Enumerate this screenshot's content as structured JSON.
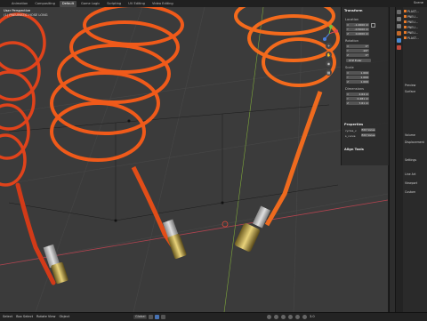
{
  "topbar": {
    "tabs": [
      "Animation",
      "Compositing",
      "Default",
      "Game Logic",
      "Scripting",
      "UV Editing",
      "Video Editing"
    ],
    "active_tab": "Default",
    "scene_label": "Scene"
  },
  "viewport": {
    "mode": "User Perspective",
    "collection": "(1) PNEUMATIC HOSE LONG",
    "npanel": {
      "transform_header": "Transform",
      "location_label": "Location",
      "location": [
        {
          "axis": "X",
          "value": "-1.0000 m"
        },
        {
          "axis": "Y",
          "value": "-0.5000 m"
        },
        {
          "axis": "Z",
          "value": "0.0000 m"
        }
      ],
      "rotation_label": "Rotation",
      "rotation": [
        {
          "axis": "X",
          "value": "0°"
        },
        {
          "axis": "Y",
          "value": "-90°"
        },
        {
          "axis": "Z",
          "value": "0°"
        }
      ],
      "rotation_mode": "XYZ Euler",
      "scale_label": "Scale",
      "scale": [
        {
          "axis": "X",
          "value": "1.000"
        },
        {
          "axis": "Y",
          "value": "1.000"
        },
        {
          "axis": "Z",
          "value": "1.000"
        }
      ],
      "dimensions_label": "Dimensions",
      "dimensions": [
        {
          "axis": "X",
          "value": "2.64 m"
        },
        {
          "axis": "Y",
          "value": "0.481 m"
        },
        {
          "axis": "Z",
          "value": "7.61 m"
        }
      ],
      "properties_header": "Properties",
      "properties": [
        {
          "name": "cycles_v",
          "button": "Edit Value"
        },
        {
          "name": "s_curve",
          "button": "Edit Value"
        }
      ],
      "align_tools_header": "Align Tools"
    }
  },
  "properties_panel": {
    "outliner": [
      {
        "name": "PLAST..."
      },
      {
        "name": "PNEU..."
      },
      {
        "name": "PNEU..."
      },
      {
        "name": "PNEU..."
      },
      {
        "name": "PNEU..."
      },
      {
        "name": "PLAST..."
      }
    ],
    "sections": [
      "Preview",
      "Surface",
      "Volume",
      "Displacement",
      "Settings",
      "Line Art",
      "Viewport",
      "Custom"
    ]
  },
  "statusbar": {
    "left_items": [
      "Select",
      "Box Select",
      "Rotate View",
      "Object"
    ],
    "mode_label": "Global",
    "version": "3.0"
  }
}
